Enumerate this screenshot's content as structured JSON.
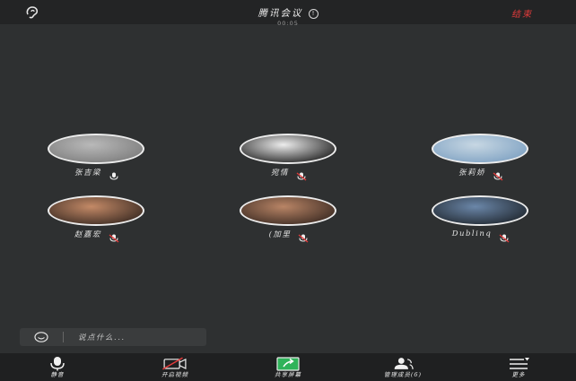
{
  "header": {
    "title": "腾讯会议",
    "timer": "00:05",
    "end_label": "结束"
  },
  "participants": [
    {
      "name": "张吉梁",
      "mic": "on",
      "avatar_colors": [
        "#b9b9b9",
        "#7d7d7d"
      ]
    },
    {
      "name": "宛情",
      "mic": "muted",
      "avatar_colors": [
        "#ededed",
        "#1f1f1f"
      ]
    },
    {
      "name": "张莉娇",
      "mic": "muted",
      "avatar_colors": [
        "#c7d7e3",
        "#7ea1c2"
      ]
    },
    {
      "name": "赵嘉宏",
      "mic": "muted",
      "avatar_colors": [
        "#c48a67",
        "#3a2a22"
      ]
    },
    {
      "name": "(加里",
      "mic": "muted",
      "avatar_colors": [
        "#b98566",
        "#3b2a22"
      ]
    },
    {
      "name": "Dublinq",
      "mic": "muted",
      "avatar_colors": [
        "#6b87a9",
        "#20272f"
      ]
    }
  ],
  "chat": {
    "placeholder": "说点什么..."
  },
  "toolbar": {
    "mute_label": "静音",
    "video_label": "开启视频",
    "share_label": "共享屏幕",
    "members_label": "管理成员(6)",
    "more_label": "更多"
  },
  "colors": {
    "background": "#2e3031",
    "topbar": "#232425",
    "toolbar": "#1f2021",
    "end_red": "#e23b3b",
    "share_green": "#2fb35a",
    "mute_red": "#e23b3b"
  }
}
